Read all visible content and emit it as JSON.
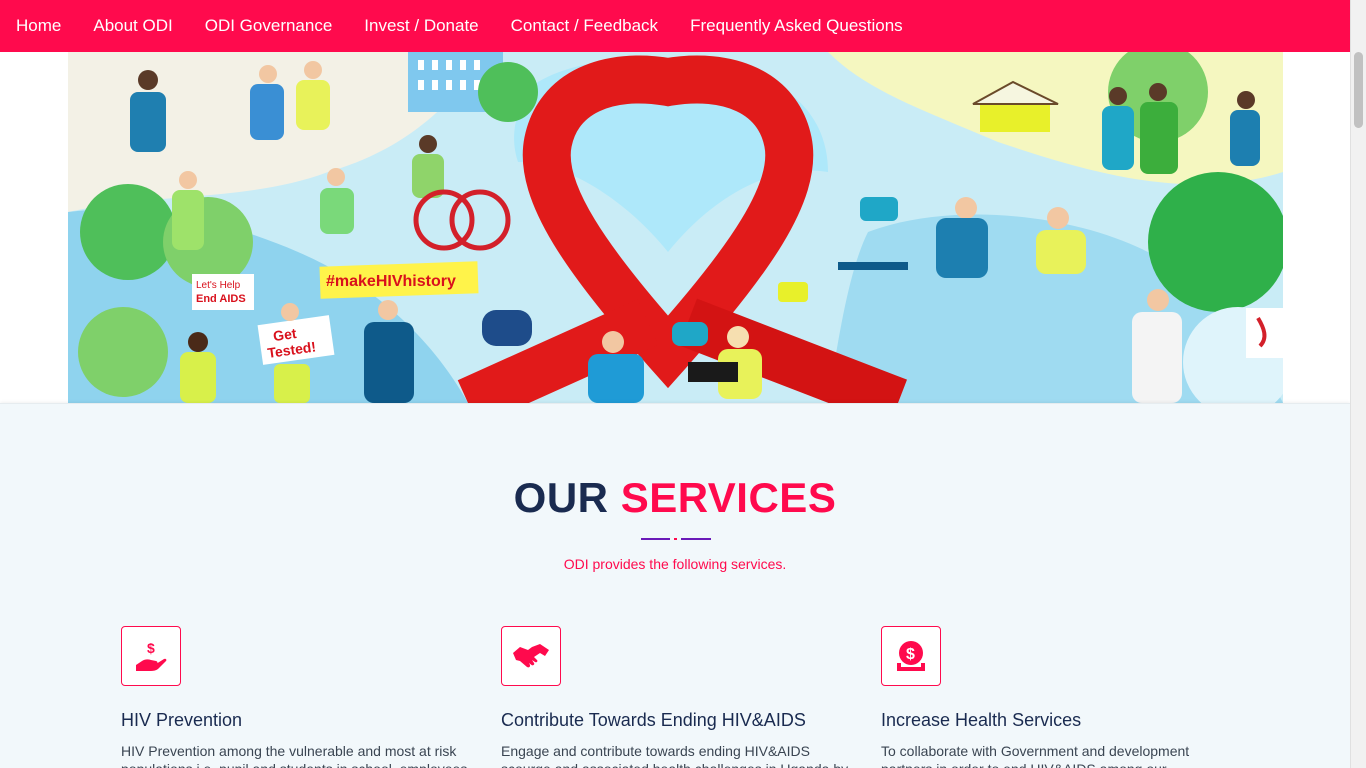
{
  "nav": {
    "items": [
      {
        "label": "Home"
      },
      {
        "label": "About ODI"
      },
      {
        "label": "ODI Governance"
      },
      {
        "label": "Invest / Donate"
      },
      {
        "label": "Contact / Feedback"
      },
      {
        "label": "Frequently Asked Questions"
      }
    ]
  },
  "hero": {
    "banner_text": {
      "sign1": "Let's Help\nEnd AIDS",
      "sign2": "#makeHIVhistory",
      "sign3": "Get\nTested!"
    },
    "slides_count": 3,
    "active_slide": 1
  },
  "services": {
    "title_part1": "OUR",
    "title_part2": "SERVICES",
    "subtitle": "ODI provides the following services.",
    "items": [
      {
        "icon": "hand-holding-dollar-icon",
        "title": "HIV Prevention",
        "text": "HIV Prevention among the vulnerable and most at risk populations i.e. pupil and students in school, employees"
      },
      {
        "icon": "handshake-icon",
        "title": "Contribute Towards Ending HIV&AIDS",
        "text": "Engage and contribute towards ending HIV&AIDS scourge and associated health challenges in Uganda by"
      },
      {
        "icon": "dollar-coin-icon",
        "title": "Increase Health Services",
        "text": "To collaborate with Government and development partners in order to end HIV&AIDS among our"
      }
    ]
  },
  "colors": {
    "brand": "#ff0a4d",
    "navy": "#1a2b50",
    "accent_purple": "#6a1ab8"
  }
}
